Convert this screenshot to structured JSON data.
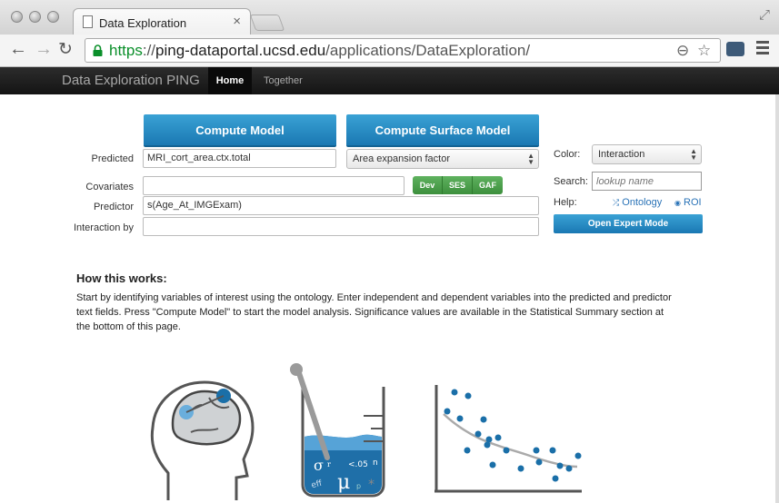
{
  "browser": {
    "tab_title": "Data Exploration",
    "url_scheme": "https",
    "url_sep": "://",
    "url_host": "ping-dataportal.ucsd.edu",
    "url_path": "/applications/DataExploration/"
  },
  "navbar": {
    "brand": "Data Exploration PING",
    "items": [
      "Home",
      "Together"
    ]
  },
  "form": {
    "compute_model": "Compute Model",
    "compute_surface_model": "Compute Surface Model",
    "predicted_label": "Predicted",
    "predicted_value": "MRI_cort_area.ctx.total",
    "surface_select": "Area expansion factor",
    "covariates_label": "Covariates",
    "covariates_value": "",
    "covariate_buttons": [
      "Dev",
      "SES",
      "GAF"
    ],
    "predictor_label": "Predictor",
    "predictor_value": "s(Age_At_IMGExam)",
    "interaction_label": "Interaction by",
    "interaction_value": ""
  },
  "side": {
    "color_label": "Color:",
    "color_value": "Interaction",
    "search_label": "Search:",
    "search_placeholder": "lookup name",
    "help_label": "Help:",
    "ontology_link": "Ontology",
    "roi_link": "ROI",
    "expert_button": "Open Expert Mode"
  },
  "info": {
    "heading": "How this works:",
    "text": "Start by identifying variables of interest using the ontology. Enter independent and dependent variables into the predicted and predictor text fields. Press \"Compute Model\" to start the model analysis. Significance values are available in the Statistical Summary section at the bottom of this page."
  },
  "illustration": {
    "beaker_symbols": [
      "σ",
      "r",
      "<.05",
      "n",
      "μ",
      "p",
      "*",
      "eff"
    ]
  },
  "colors": {
    "accent": "#1f84c0",
    "group_green": "#4a9e4a",
    "scatter_dot": "#1a6fa8"
  }
}
